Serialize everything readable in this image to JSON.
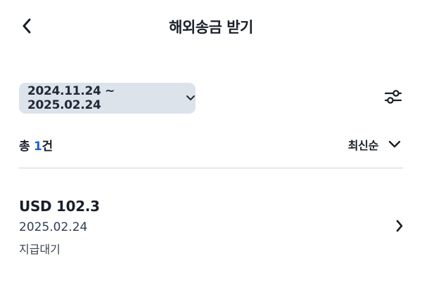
{
  "header": {
    "title": "해외송금 받기",
    "back_icon": "chevron-left-icon"
  },
  "filter": {
    "date_range": "2024.11.24 ~ 2025.02.24",
    "date_chevron_icon": "chevron-down-icon",
    "filter_icon": "filter-sliders-icon"
  },
  "summary": {
    "prefix": "총 ",
    "count": "1",
    "suffix": "건"
  },
  "sort": {
    "label": "최신순",
    "chevron_icon": "chevron-down-icon"
  },
  "transactions": [
    {
      "amount": "USD 102.3",
      "date": "2025.02.24",
      "status": "지급대기",
      "chevron_icon": "chevron-right-icon"
    }
  ],
  "colors": {
    "accent": "#1c5fd6",
    "chip_background": "#dde3ea",
    "divider": "#cfd3d9",
    "text_primary": "#191f28",
    "text_date": "#2c3e5a"
  }
}
